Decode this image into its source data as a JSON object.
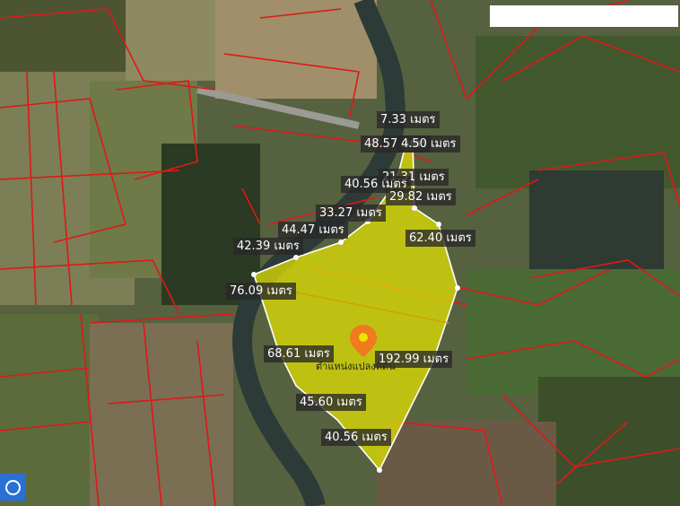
{
  "map": {
    "area_fill": "#e6e600",
    "parcel_line": "#e01818",
    "pin_color": "#f07a1e",
    "place_label": "ตำแหน่งแปลงที่ดิน",
    "measurements": [
      {
        "id": "m1",
        "text": "7.33 เมตร"
      },
      {
        "id": "m2",
        "text": "48.57 เมตร"
      },
      {
        "id": "m3",
        "text": "4.50 เมตร"
      },
      {
        "id": "m4",
        "text": "21.31 เมตร"
      },
      {
        "id": "m5",
        "text": "40.56 เมตร"
      },
      {
        "id": "m6",
        "text": "29.82 เมตร"
      },
      {
        "id": "m7",
        "text": "33.27 เมตร"
      },
      {
        "id": "m8",
        "text": "44.47 เมตร"
      },
      {
        "id": "m9",
        "text": "62.40 เมตร"
      },
      {
        "id": "m10",
        "text": "42.39 เมตร"
      },
      {
        "id": "m11",
        "text": "76.09 เมตร"
      },
      {
        "id": "m12",
        "text": "68.61 เมตร"
      },
      {
        "id": "m13",
        "text": "192.99 เมตร"
      },
      {
        "id": "m14",
        "text": "45.60 เมตร"
      },
      {
        "id": "m15",
        "text": "40.56 เมตร"
      }
    ]
  }
}
